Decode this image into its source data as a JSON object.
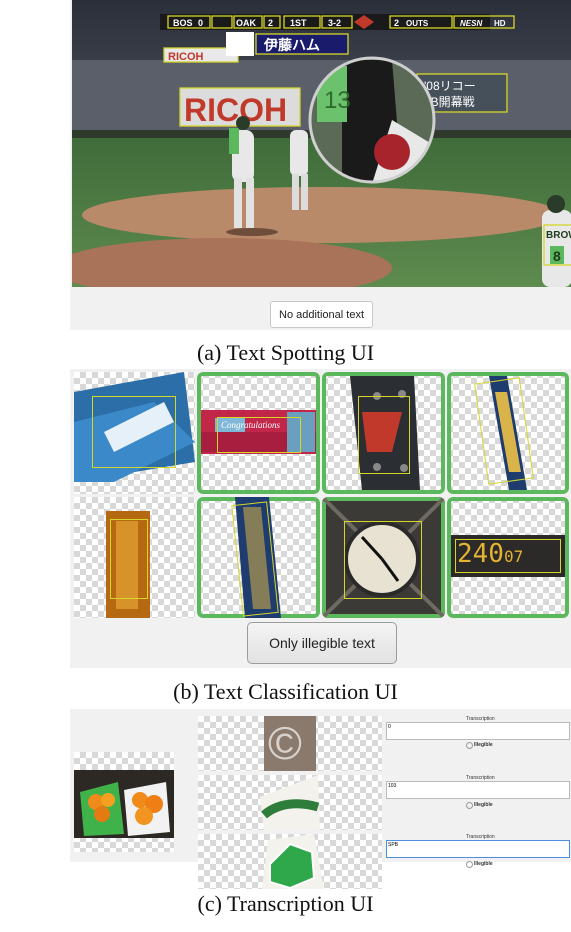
{
  "spotting": {
    "scoreboard": [
      "BOS",
      "0",
      "OAK",
      "2",
      "1ST",
      "3-2",
      "2",
      "OUTS",
      "NESN",
      "HD"
    ],
    "signs": [
      "RICOH",
      "伊藤ハム",
      "RICOH",
      "'08リコー",
      "LB開幕戦"
    ],
    "zoom_number": "13",
    "player_name": "BROW",
    "player_number": "8",
    "button": "No additional text",
    "caption": "(a) Text Spotting UI"
  },
  "classification": {
    "tile_texts": [
      "Congratulations",
      "240",
      "07"
    ],
    "button": "Only illegible text",
    "caption": "(b) Text Classification UI"
  },
  "transcription": {
    "header_label": "Transcription",
    "illegible_label": "Illegible",
    "rows": [
      {
        "value": "0"
      },
      {
        "value": "103"
      },
      {
        "value": "SPB"
      }
    ],
    "caption": "(c) Transcription UI"
  }
}
